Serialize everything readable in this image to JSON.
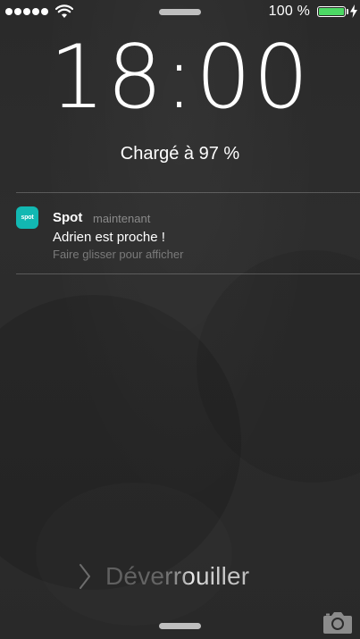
{
  "status_bar": {
    "signal_dots": 5,
    "wifi_icon": "wifi-icon",
    "battery_percent": "100 %",
    "battery_level": 1.0,
    "battery_color": "#4cd964",
    "charging_icon": "bolt-icon"
  },
  "lock_screen": {
    "time": "18:00",
    "charge_status": "Chargé à 97 %"
  },
  "notification": {
    "app_icon_label": "spot",
    "app_icon_color": "#12b8b2",
    "app_name": "Spot",
    "time": "maintenant",
    "message": "Adrien est proche !",
    "hint": "Faire glisser pour afficher"
  },
  "unlock": {
    "chevron_icon": "chevron-right-icon",
    "label": "Déverrouiller"
  },
  "camera": {
    "icon": "camera-icon"
  }
}
